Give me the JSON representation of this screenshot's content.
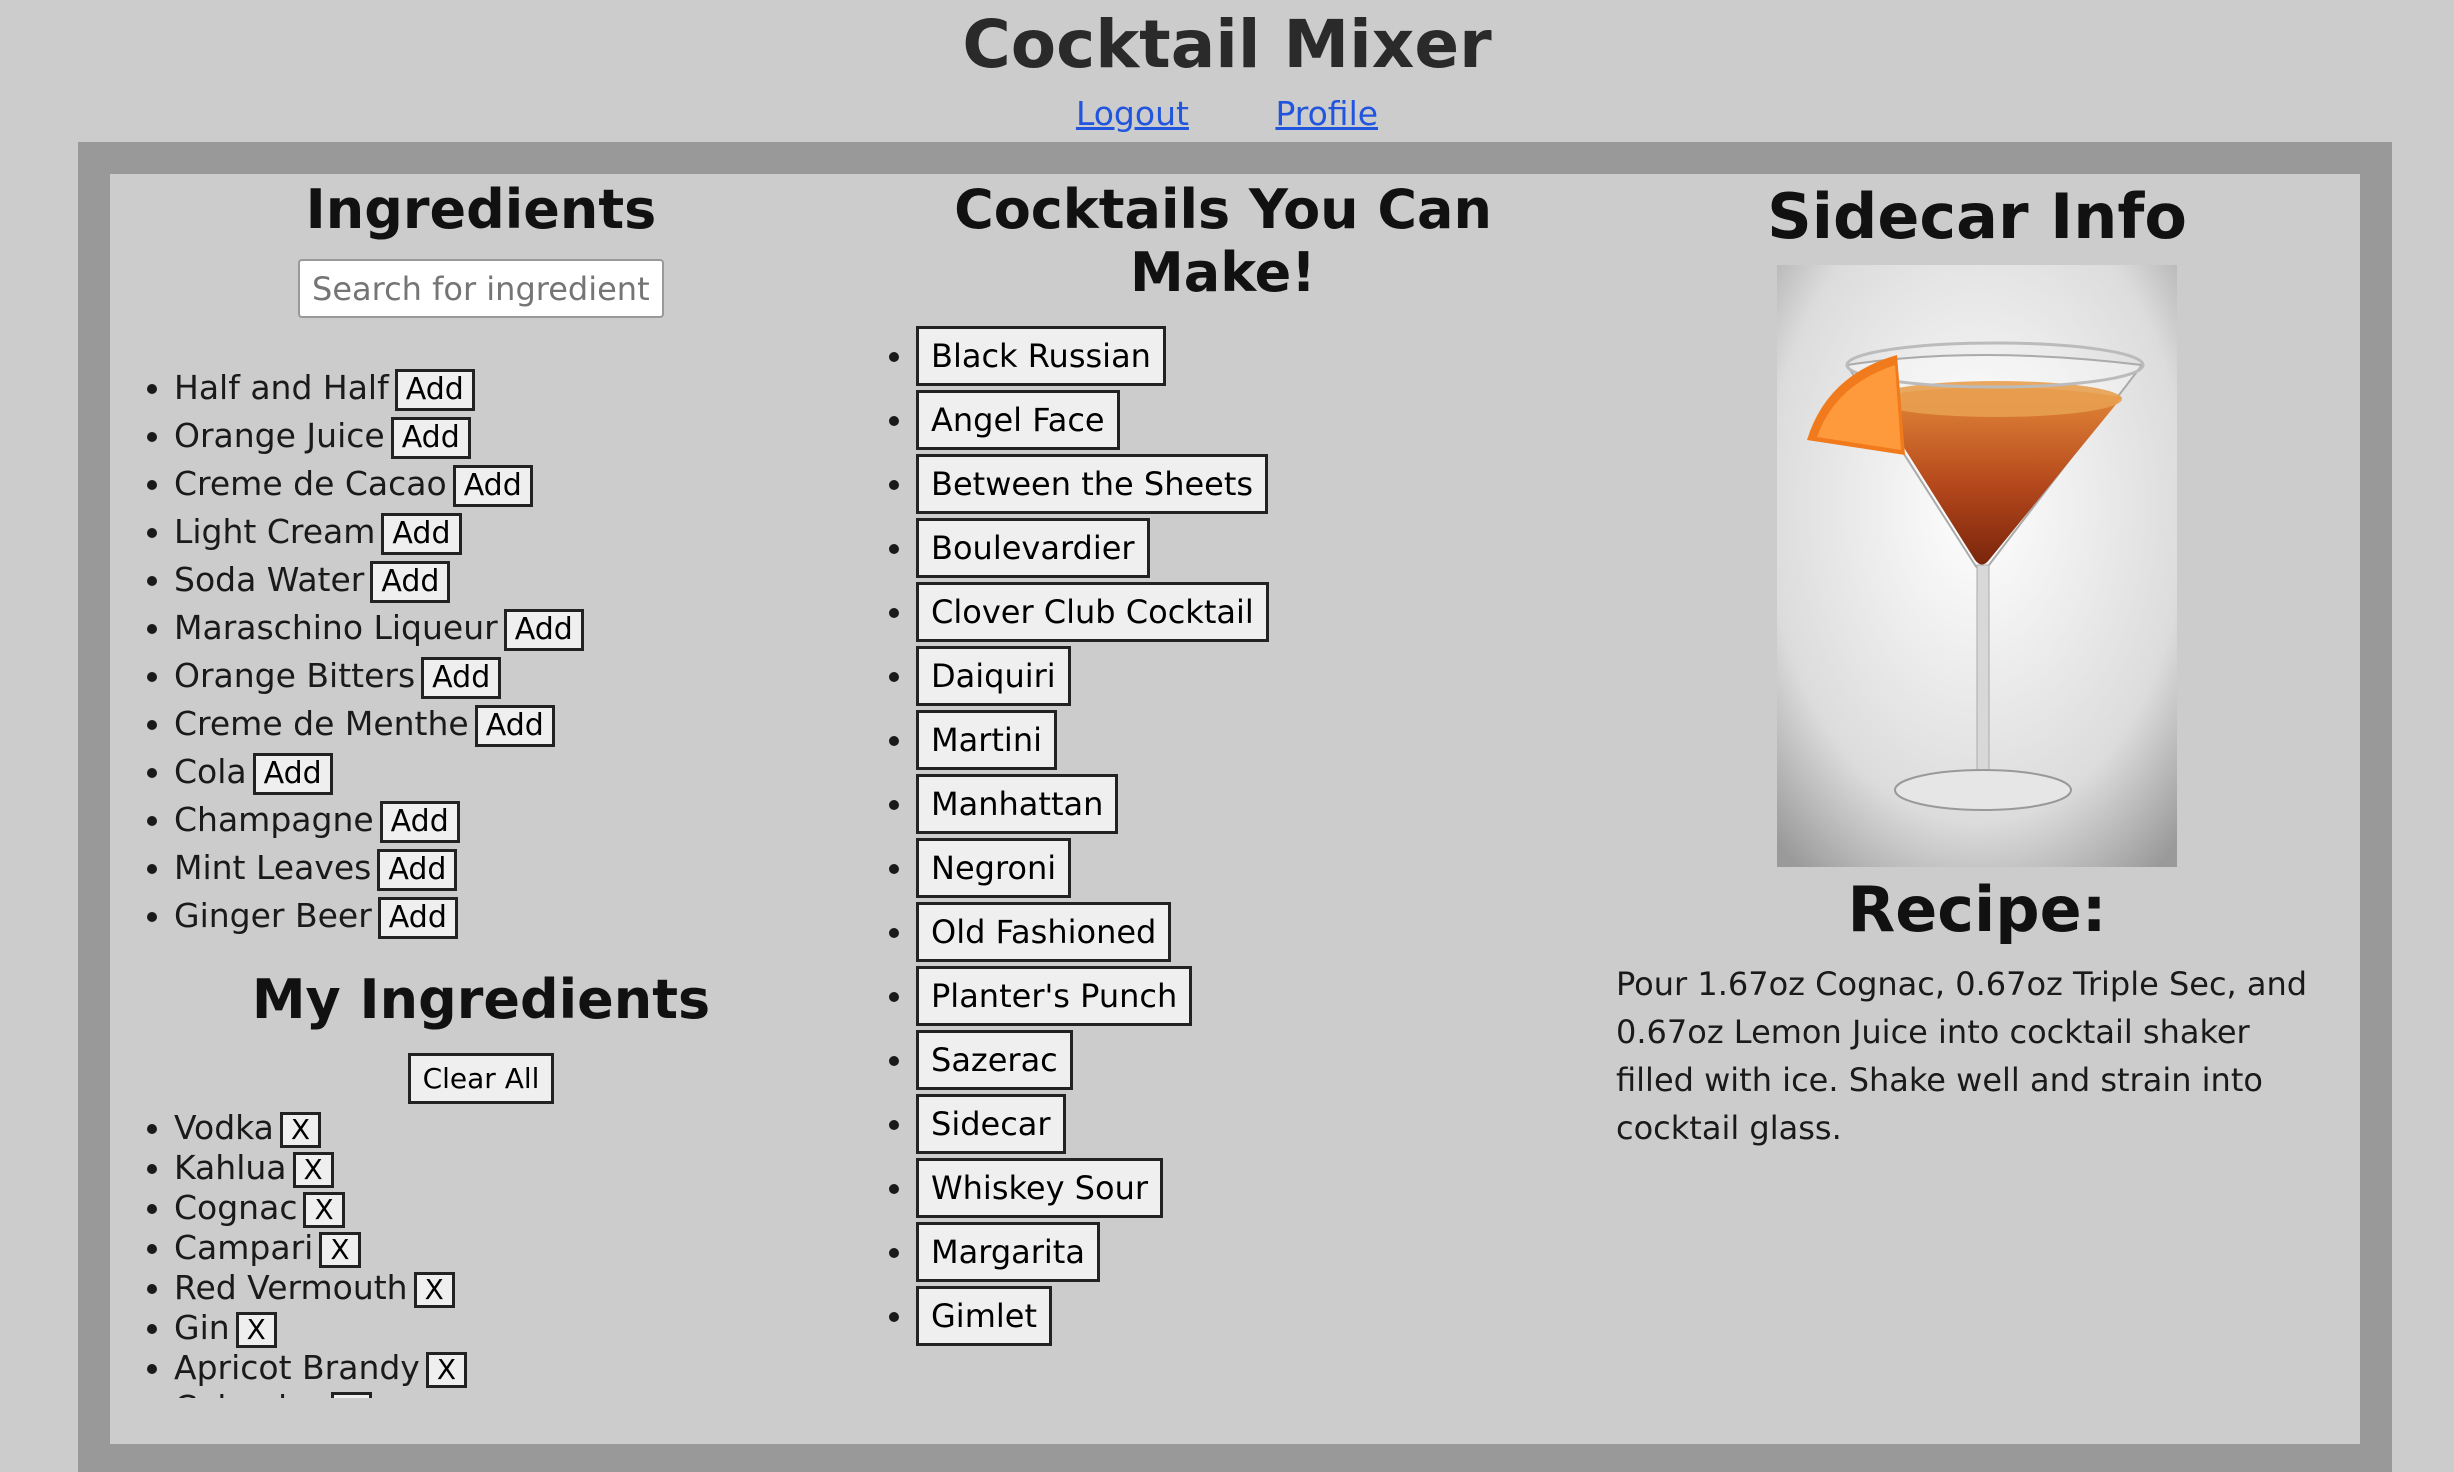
{
  "header": {
    "title": "Cocktail Mixer",
    "links": [
      "Logout",
      "Profile"
    ]
  },
  "ingredients": {
    "heading": "Ingredients",
    "search_placeholder": "Search for ingredients..",
    "add_label": "Add",
    "items": [
      "Half and Half",
      "Orange Juice",
      "Creme de Cacao",
      "Light Cream",
      "Soda Water",
      "Maraschino Liqueur",
      "Orange Bitters",
      "Creme de Menthe",
      "Cola",
      "Champagne",
      "Mint Leaves",
      "Ginger Beer"
    ]
  },
  "my_ingredients": {
    "heading": "My Ingredients",
    "clear_label": "Clear All",
    "remove_label": "X",
    "items": [
      "Vodka",
      "Kahlua",
      "Cognac",
      "Campari",
      "Red Vermouth",
      "Gin",
      "Apricot Brandy",
      "Calvados"
    ]
  },
  "cocktails": {
    "heading": "Cocktails You Can Make!",
    "items": [
      "Black Russian",
      "Angel Face",
      "Between the Sheets",
      "Boulevardier",
      "Clover Club Cocktail",
      "Daiquiri",
      "Martini",
      "Manhattan",
      "Negroni",
      "Old Fashioned",
      "Planter's Punch",
      "Sazerac",
      "Sidecar",
      "Whiskey Sour",
      "Margarita",
      "Gimlet"
    ]
  },
  "info": {
    "heading": "Sidecar Info",
    "recipe_heading": "Recipe:",
    "recipe_text": "Pour 1.67oz Cognac, 0.67oz Triple Sec, and 0.67oz Lemon Juice into cocktail shaker filled with ice. Shake well and strain into cocktail glass."
  },
  "colors": {
    "background": "#cccccc",
    "frame": "#999999",
    "link": "#2255dd"
  }
}
